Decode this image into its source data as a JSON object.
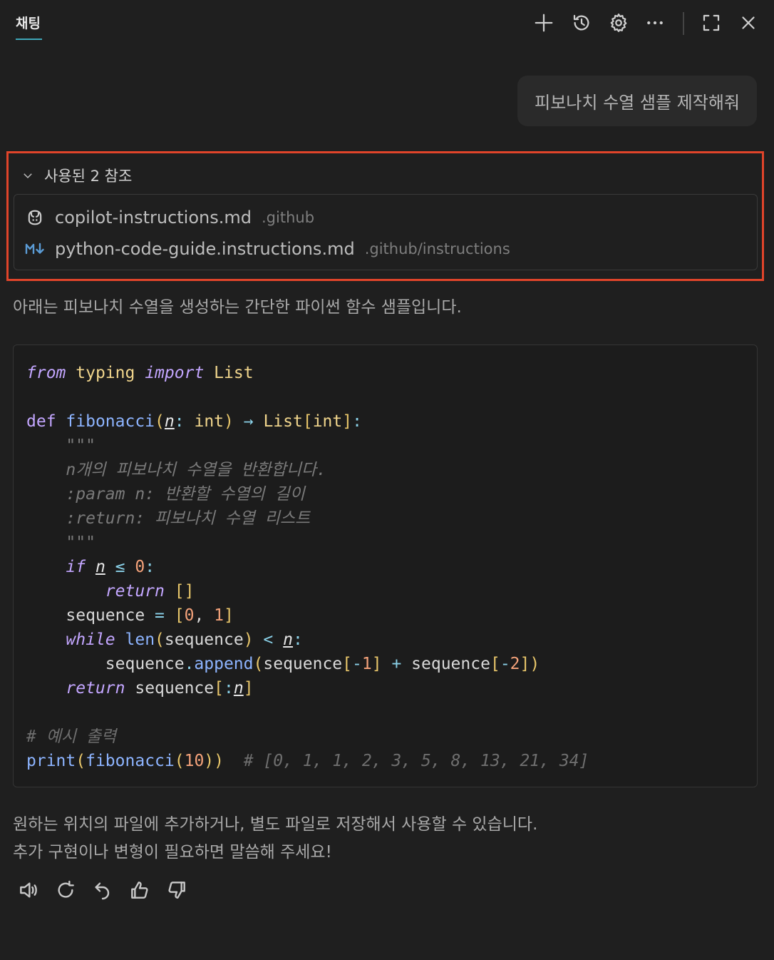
{
  "header": {
    "tab_label": "채팅",
    "icons": [
      "plus-icon",
      "history-icon",
      "gear-icon",
      "more-icon",
      "maximize-icon",
      "close-icon"
    ]
  },
  "user_message": "피보나치 수열 샘플 제작해줘",
  "references": {
    "header": "사용된 2 참조",
    "items": [
      {
        "name": "copilot-instructions.md",
        "path": ".github",
        "icon": "copilot-icon"
      },
      {
        "name": "python-code-guide.instructions.md",
        "path": ".github/instructions",
        "icon": "markdown-icon"
      }
    ]
  },
  "response": {
    "intro": "아래는 피보나치 수열을 생성하는 간단한 파이썬 함수 샘플입니다.",
    "code_lines": [
      "from typing import List",
      "",
      "def fibonacci(n: int) → List[int]:",
      "    \"\"\"",
      "    n개의 피보나치 수열을 반환합니다.",
      "    :param n: 반환할 수열의 길이",
      "    :return: 피보나치 수열 리스트",
      "    \"\"\"",
      "    if n ≤ 0:",
      "        return []",
      "    sequence = [0, 1]",
      "    while len(sequence) < n:",
      "        sequence.append(sequence[-1] + sequence[-2])",
      "    return sequence[:n]",
      "",
      "# 예시 출력",
      "print(fibonacci(10))  # [0, 1, 1, 2, 3, 5, 8, 13, 21, 34]"
    ],
    "outro_line1": "원하는 위치의 파일에 추가하거나, 별도 파일로 저장해서 사용할 수 있습니다.",
    "outro_line2": "추가 구현이나 변형이 필요하면 말씀해 주세요!"
  },
  "actions": [
    "speaker-icon",
    "retry-icon",
    "undo-icon",
    "thumbs-up-icon",
    "thumbs-down-icon"
  ]
}
